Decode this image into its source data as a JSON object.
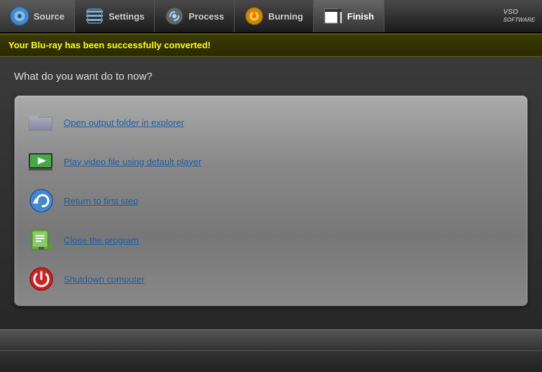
{
  "nav": {
    "items": [
      {
        "id": "source",
        "label": "Source",
        "active": false
      },
      {
        "id": "settings",
        "label": "Settings",
        "active": false
      },
      {
        "id": "process",
        "label": "Process",
        "active": false
      },
      {
        "id": "burning",
        "label": "Burning",
        "active": false
      },
      {
        "id": "finish",
        "label": "Finish",
        "active": true
      }
    ],
    "logo": "VSO"
  },
  "banner": {
    "text": "Your Blu-ray has been successfully converted!"
  },
  "main": {
    "question": "What do you want do to now?",
    "options": [
      {
        "id": "open-folder",
        "label": "Open output folder in explorer",
        "icon": "📁"
      },
      {
        "id": "play-video",
        "label": "Play video file using default player",
        "icon": "🖥"
      },
      {
        "id": "return-first",
        "label": "Return to first step",
        "icon": "🔄"
      },
      {
        "id": "close-program",
        "label": "Close the program",
        "icon": "🚪"
      },
      {
        "id": "shutdown",
        "label": "Shutdown computer",
        "icon": "⏻"
      }
    ]
  }
}
